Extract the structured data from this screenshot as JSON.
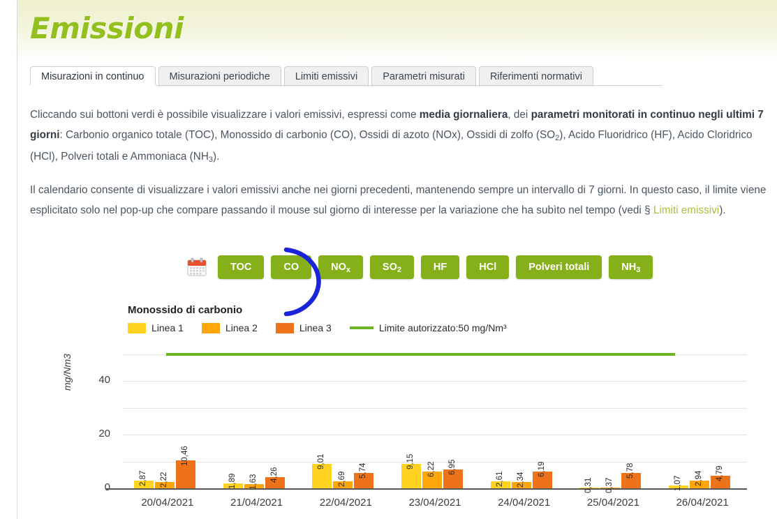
{
  "header": {
    "title": "Emissioni",
    "title_color": "#93c01f"
  },
  "tabs": [
    {
      "label": "Misurazioni in continuo",
      "active": true
    },
    {
      "label": "Misurazioni periodiche",
      "active": false
    },
    {
      "label": "Limiti emissivi",
      "active": false
    },
    {
      "label": "Parametri misurati",
      "active": false
    },
    {
      "label": "Riferimenti normativi",
      "active": false
    }
  ],
  "paragraphs": {
    "p1": {
      "s1": "Cliccando sui bottoni verdi è possibile visualizzare i valori emissivi, espressi come ",
      "b1": "media giornaliera",
      "s2": ", dei ",
      "b2": "parametri monitorati in continuo negli ultimi 7 giorni",
      "s3": ": Carbonio organico totale (TOC), Monossido di carbonio (CO), Ossidi di azoto (NOx), Ossidi di zolfo (SO",
      "sub1": "2",
      "s4": "), Acido Fluoridrico (HF), Acido Cloridrico (HCl), Polveri totali e Ammoniaca (NH",
      "sub2": "3",
      "s5": ")."
    },
    "p2": {
      "s1": "Il calendario consente di visualizzare i valori emissivi anche nei giorni precedenti, mantenendo sempre un intervallo di 7 giorni. In questo caso, il limite viene esplicitato solo nel pop-up che compare passando il mouse sul giorno di interesse per la variazione che ha subìto nel tempo (vedi § ",
      "link": "Limiti emissivi",
      "s2": ")."
    }
  },
  "toolbar": {
    "calendar_icon": "calendar-icon",
    "buttons": [
      {
        "label": "TOC",
        "sub": ""
      },
      {
        "label": "CO",
        "sub": ""
      },
      {
        "label": "NO",
        "sub": "x"
      },
      {
        "label": "SO",
        "sub": "2"
      },
      {
        "label": "HF",
        "sub": ""
      },
      {
        "label": "HCl",
        "sub": ""
      },
      {
        "label": "Polveri totali",
        "sub": ""
      },
      {
        "label": "NH",
        "sub": "3"
      }
    ],
    "button_color": "#86b01a",
    "annotation": "blue-arc-highlight-around-co-button"
  },
  "chart_data": {
    "type": "bar",
    "title": "Monossido di carbonio",
    "xlabel": "",
    "ylabel": "mg/Nm3",
    "ylim": [
      0,
      52
    ],
    "yticks": [
      0,
      20,
      40
    ],
    "gridlines": [
      0,
      10,
      20,
      30,
      40,
      50
    ],
    "grid": true,
    "legend_position": "top-left",
    "categories": [
      "20/04/2021",
      "21/04/2021",
      "22/04/2021",
      "23/04/2021",
      "24/04/2021",
      "25/04/2021",
      "26/04/2021"
    ],
    "series": [
      {
        "name": "Linea 1",
        "color": "#FFD320",
        "values": [
          2.87,
          1.89,
          9.01,
          9.15,
          2.61,
          0.31,
          1.07
        ],
        "labels": [
          "2,87",
          "1,89",
          "9,01",
          "9,15",
          "2,61",
          "0,31",
          "1,07"
        ]
      },
      {
        "name": "Linea 2",
        "color": "#FFA60A",
        "values": [
          2.22,
          1.63,
          2.69,
          6.22,
          2.34,
          0.37,
          2.94
        ],
        "labels": [
          "2,22",
          "1,63",
          "2,69",
          "6,22",
          "2,34",
          "0,37",
          "2,94"
        ]
      },
      {
        "name": "Linea 3",
        "color": "#EE7219",
        "values": [
          10.46,
          4.26,
          5.74,
          6.95,
          6.19,
          5.78,
          4.79
        ],
        "labels": [
          "10,46",
          "4,26",
          "5,74",
          "6,95",
          "6,19",
          "5,78",
          "4,79"
        ]
      }
    ],
    "limit": {
      "label": "Limite autorizzato:50 mg/Nm³",
      "value": 50,
      "color": "#6cb424"
    }
  }
}
